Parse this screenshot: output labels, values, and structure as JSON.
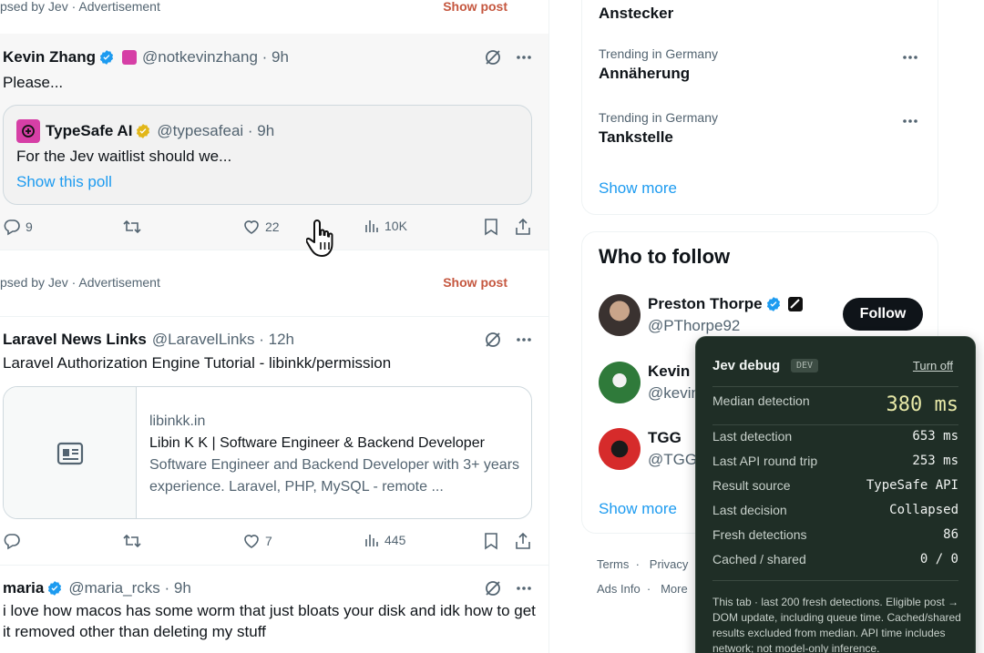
{
  "feed": {
    "collapsed_top": {
      "text": "psed by Jev · Advertisement",
      "show_label": "Show post"
    },
    "tweet1": {
      "name": "Kevin Zhang",
      "handle": "@notkevinzhang · 9h",
      "text": "Please...",
      "quote": {
        "name": "TypeSafe AI",
        "handle": "@typesafeai · 9h",
        "text": "For the Jev waitlist should we...",
        "link": "Show this poll"
      },
      "replies": "9",
      "likes": "22",
      "views": "10K"
    },
    "collapsed_mid": {
      "text": "psed by Jev · Advertisement",
      "show_label": "Show post"
    },
    "tweet2": {
      "name": "Laravel News Links",
      "handle": "@LaravelLinks · 12h",
      "text": "Laravel Authorization Engine Tutorial - libinkk/permission",
      "card": {
        "domain": "libinkk.in",
        "title": "Libin K K | Software Engineer & Backend Developer",
        "desc": "Software Engineer and Backend Developer with 3+ years experience. Laravel, PHP, MySQL - remote ..."
      },
      "likes": "7",
      "views": "445"
    },
    "tweet3": {
      "name": "maria",
      "handle": "@maria_rcks · 9h",
      "text": "i love how macos has some worm that just bloats your disk and idk how to get it removed other than deleting my stuff"
    }
  },
  "trends": {
    "top_item": "Anstecker",
    "items": [
      {
        "context": "Trending in Germany",
        "name": "Annäherung"
      },
      {
        "context": "Trending in Germany",
        "name": "Tankstelle"
      }
    ],
    "show_more": "Show more"
  },
  "who_to_follow": {
    "title": "Who to follow",
    "accounts": [
      {
        "name": "Preston Thorpe",
        "handle": "@PThorpe92"
      },
      {
        "name": "Kevin N",
        "handle": "@kevin"
      },
      {
        "name": "TGG",
        "handle": "@TGG"
      }
    ],
    "follow_label": "Follow",
    "show_more": "Show more"
  },
  "footer": {
    "row1": "Terms  ·   Privacy",
    "row2": "Ads Info  ·   More"
  },
  "debug": {
    "title": "Jev debug",
    "badge": "DEV",
    "turn_off": "Turn off",
    "median_label": "Median detection",
    "median_value": "380 ms",
    "rows": [
      {
        "label": "Last detection",
        "value": "653 ms"
      },
      {
        "label": "Last API round trip",
        "value": "253 ms"
      },
      {
        "label": "Result source",
        "value": "TypeSafe API"
      },
      {
        "label": "Last decision",
        "value": "Collapsed"
      },
      {
        "label": "Fresh detections",
        "value": "86"
      },
      {
        "label": "Cached / shared",
        "value": "0 / 0"
      }
    ],
    "note": "This tab · last 200 fresh detections. Eligible post → DOM update, including queue time. Cached/shared results excluded from median. API time includes network; not model-only inference."
  },
  "colors": {
    "accent": "#1d9bf0",
    "show_post": "#c5573f",
    "debug_bg": "#1f2e26",
    "follow_bg": "#0f1419"
  }
}
